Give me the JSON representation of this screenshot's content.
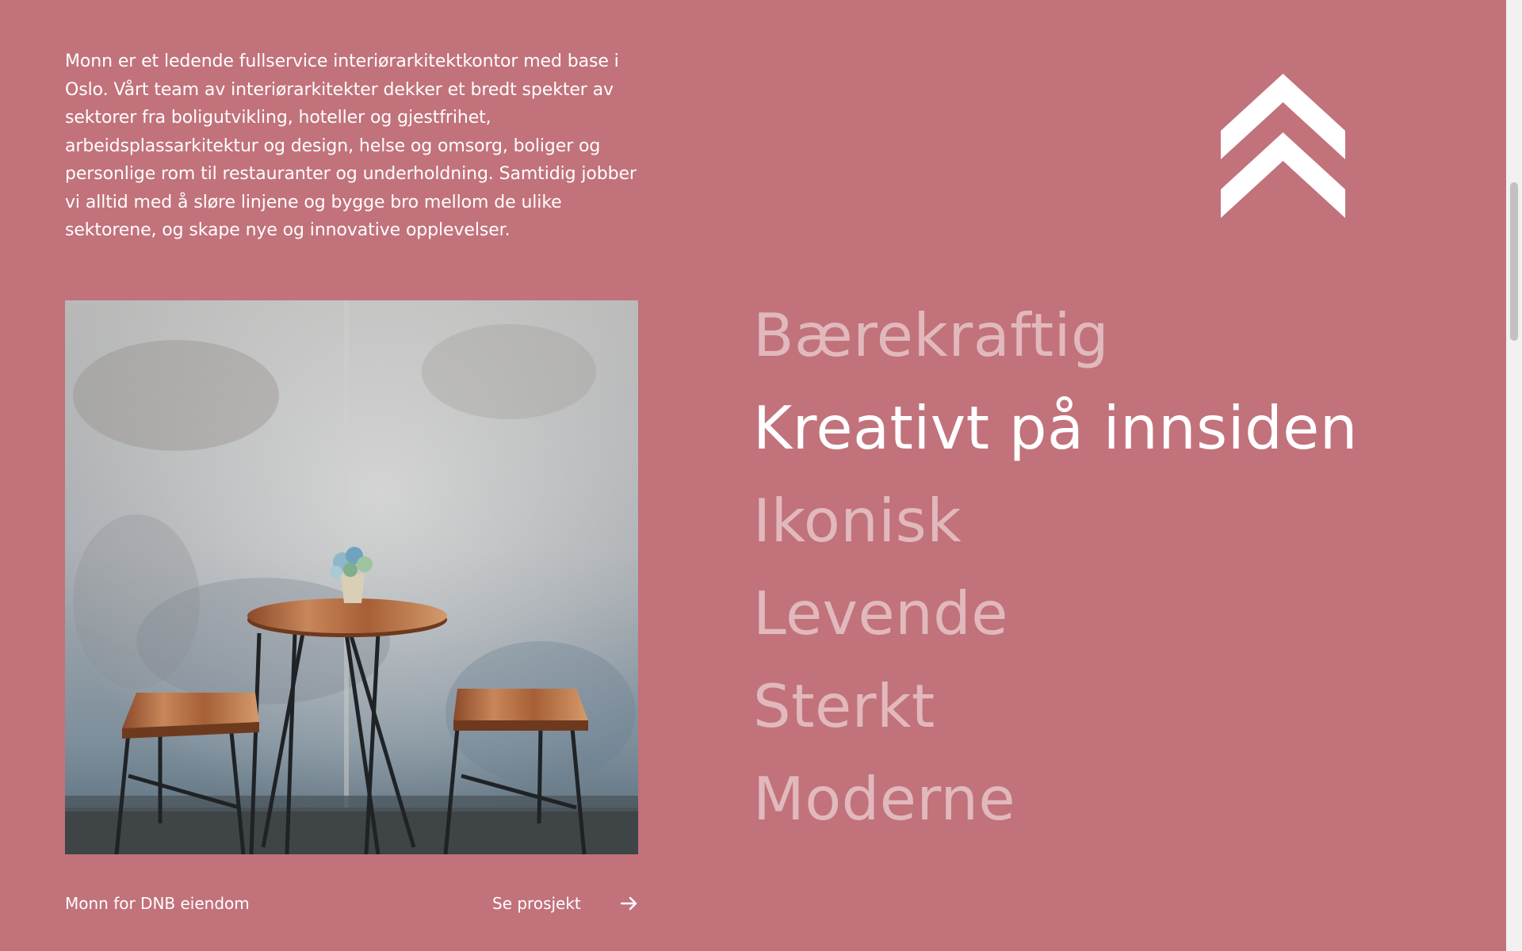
{
  "intro": {
    "text": "Monn er et ledende fullservice interiørarkitektkontor med base i Oslo. Vårt team av interiørarkitekter dekker et bredt spekter av sektorer fra boligutvikling, hoteller og gjestfrihet, arbeidsplassarkitektur og design, helse og omsorg, boliger og personlige rom til restauranter og underholdning. Samtidig jobber vi alltid med å sløre linjene og bygge bro mellom de ulike sektorene, og skape nye og innovative opplevelser."
  },
  "logo": {
    "icon": "double-chevron-up-icon"
  },
  "project": {
    "label": "Monn for DNB eiendom",
    "link_label": "Se prosjekt",
    "link_icon": "arrow-right-icon"
  },
  "words": [
    {
      "label": "Bærekraftig",
      "active": false
    },
    {
      "label": "Kreativt på innsiden",
      "active": true
    },
    {
      "label": "Ikonisk",
      "active": false
    },
    {
      "label": "Levende",
      "active": false
    },
    {
      "label": "Sterkt",
      "active": false
    },
    {
      "label": "Moderne",
      "active": false
    }
  ],
  "colors": {
    "background": "#c2727b",
    "text": "#ffffff",
    "inactive_word": "rgba(255,255,255,0.5)"
  }
}
